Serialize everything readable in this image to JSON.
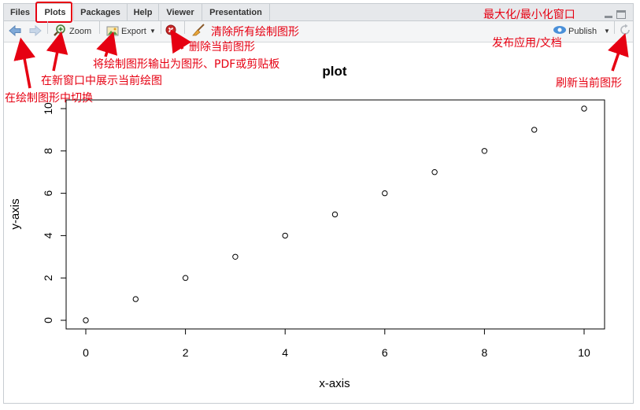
{
  "tabs": [
    {
      "label": "Files"
    },
    {
      "label": "Plots"
    },
    {
      "label": "Packages"
    },
    {
      "label": "Help"
    },
    {
      "label": "Viewer"
    },
    {
      "label": "Presentation"
    }
  ],
  "toolbar": {
    "zoom_label": "Zoom",
    "export_label": "Export",
    "publish_label": "Publish"
  },
  "annotations": {
    "maximize": "最大化/最小化窗口",
    "publish": "发布应用/文档",
    "refresh": "刷新当前图形",
    "clear_all": "清除所有绘制图形",
    "delete_current": "删除当前图形",
    "export": "将绘制图形输出为图形、PDF或剪贴板",
    "zoom": "在新窗口中展示当前绘图",
    "navigate": "在绘制图形中切换"
  },
  "colors": {
    "annotation": "#e60012",
    "accent": "#4a90d9"
  },
  "chart_data": {
    "type": "scatter",
    "title": "plot",
    "xlabel": "x-axis",
    "ylabel": "y-axis",
    "x": [
      0,
      1,
      2,
      3,
      4,
      5,
      6,
      7,
      8,
      9,
      10
    ],
    "y": [
      0,
      1,
      2,
      3,
      4,
      5,
      6,
      7,
      8,
      9,
      10
    ],
    "xlim": [
      0,
      10
    ],
    "ylim": [
      0,
      10
    ],
    "xticks": [
      0,
      2,
      4,
      6,
      8,
      10
    ],
    "yticks": [
      0,
      2,
      4,
      6,
      8,
      10
    ],
    "grid": false,
    "marker": "open-circle"
  }
}
